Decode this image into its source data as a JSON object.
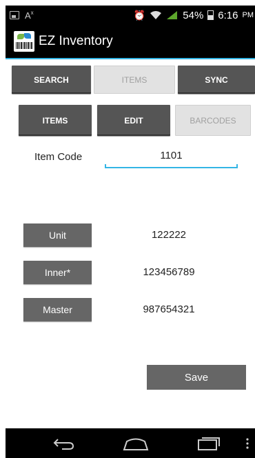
{
  "status_bar": {
    "accessibility_text": "A",
    "battery_percent": "54%",
    "time": "6:16",
    "ampm": "PM",
    "icons": [
      "image-notification-icon",
      "alarm-icon",
      "wifi-icon",
      "signal-icon",
      "battery-icon"
    ]
  },
  "action_bar": {
    "title": "EZ Inventory",
    "accent_color": "#33b5e5"
  },
  "main_tabs": [
    {
      "label": "SEARCH",
      "selected": false
    },
    {
      "label": "ITEMS",
      "selected": true
    },
    {
      "label": "SYNC",
      "selected": false
    }
  ],
  "sub_tabs": [
    {
      "label": "ITEMS",
      "selected": false
    },
    {
      "label": "EDIT",
      "selected": false
    },
    {
      "label": "BARCODES",
      "selected": true
    }
  ],
  "item_code": {
    "label": "Item Code",
    "value": "1101"
  },
  "barcodes": [
    {
      "button": "Unit",
      "value": "122222"
    },
    {
      "button": "Inner*",
      "value": "123456789"
    },
    {
      "button": "Master",
      "value": "987654321"
    }
  ],
  "save_label": "Save",
  "nav_bar": {
    "icons": [
      "back-icon",
      "home-icon",
      "recent-apps-icon",
      "overflow-menu-icon"
    ]
  }
}
